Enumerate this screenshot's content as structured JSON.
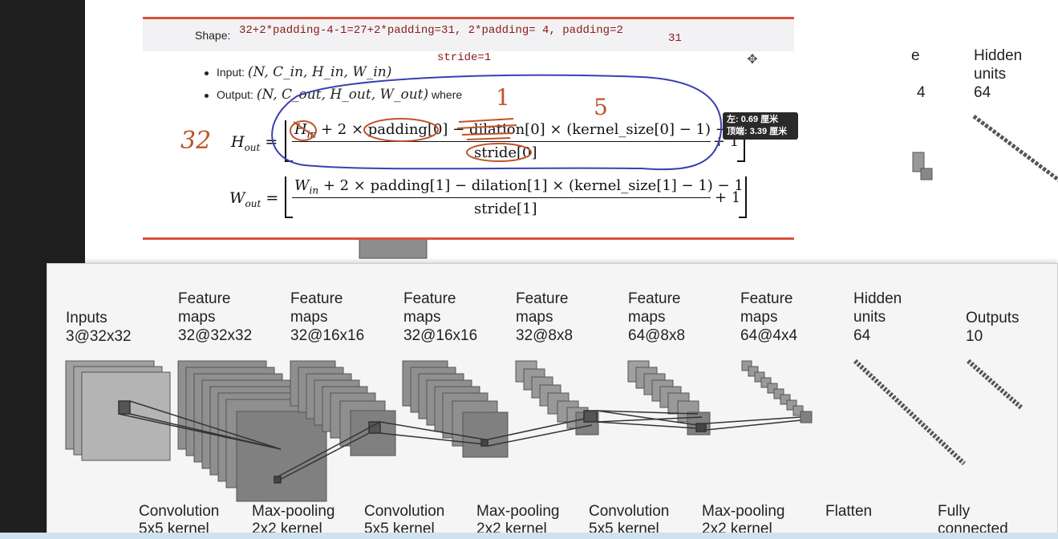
{
  "document": {
    "shape_label": "Shape:",
    "shape_annotation": "32+2*padding-4-1=27+2*padding=31, 2*padding= 4, padding=2",
    "shape_annotation_31": "31",
    "stride_annotation": "stride=1",
    "input_bullet_label": "Input:",
    "input_bullet_math": "(N, C_in, H_in, W_in)",
    "output_bullet_label": "Output:",
    "output_bullet_math": "(N, C_out, H_out, W_out)",
    "output_bullet_suffix": "where",
    "h_out_lhs": "H",
    "h_out_sub": "out",
    "h_numerator_h": "H",
    "h_numerator_sub": "in",
    "h_numerator_rest": " + 2 × padding[0] − dilation[0] × (kernel_size[0] − 1) − 1",
    "h_denominator": "stride[0]",
    "w_out_lhs": "W",
    "w_out_sub": "out",
    "w_numerator_w": "W",
    "w_numerator_sub": "in",
    "w_numerator_rest": " + 2 × padding[1] − dilation[1] × (kernel_size[1] − 1) − 1",
    "w_denominator": "stride[1]",
    "plus_one": "+ 1",
    "handwritten_32": "32",
    "handwritten_1": "1",
    "handwritten_5": "5"
  },
  "tooltip": {
    "line1": "左: 0.69 厘米",
    "line2": "顶端: 3.39 厘米"
  },
  "background_diagram": {
    "partial_letter": "e",
    "partial_value": "4",
    "hidden_title": "Hidden",
    "hidden_sub": "units",
    "hidden_value": "64"
  },
  "cnn_diagram": {
    "layers": [
      {
        "title": "Inputs",
        "size": "3@32x32"
      },
      {
        "title": "Feature",
        "sub": "maps",
        "size": "32@32x32"
      },
      {
        "title": "Feature",
        "sub": "maps",
        "size": "32@16x16"
      },
      {
        "title": "Feature",
        "sub": "maps",
        "size": "32@16x16"
      },
      {
        "title": "Feature",
        "sub": "maps",
        "size": "32@8x8"
      },
      {
        "title": "Feature",
        "sub": "maps",
        "size": "64@8x8"
      },
      {
        "title": "Feature",
        "sub": "maps",
        "size": "64@4x4"
      },
      {
        "title": "Hidden",
        "sub": "units",
        "size": "64"
      },
      {
        "title": "Outputs",
        "size": "10"
      }
    ],
    "operations": [
      {
        "name": "Convolution",
        "detail": "5x5 kernel"
      },
      {
        "name": "Max-pooling",
        "detail": "2x2 kernel"
      },
      {
        "name": "Convolution",
        "detail": "5x5 kernel"
      },
      {
        "name": "Max-pooling",
        "detail": "2x2 kernel"
      },
      {
        "name": "Convolution",
        "detail": "5x5 kernel"
      },
      {
        "name": "Max-pooling",
        "detail": "2x2 kernel"
      },
      {
        "name": "Flatten",
        "detail": ""
      },
      {
        "name": "Fully",
        "detail": "connected"
      }
    ]
  },
  "colors": {
    "red_rule": "#d9523b",
    "annotation_text": "#8b1a1a",
    "pen_blue": "#3b3fb0",
    "pen_orange": "#c0532a",
    "left_bar": "#1f1f1f"
  }
}
